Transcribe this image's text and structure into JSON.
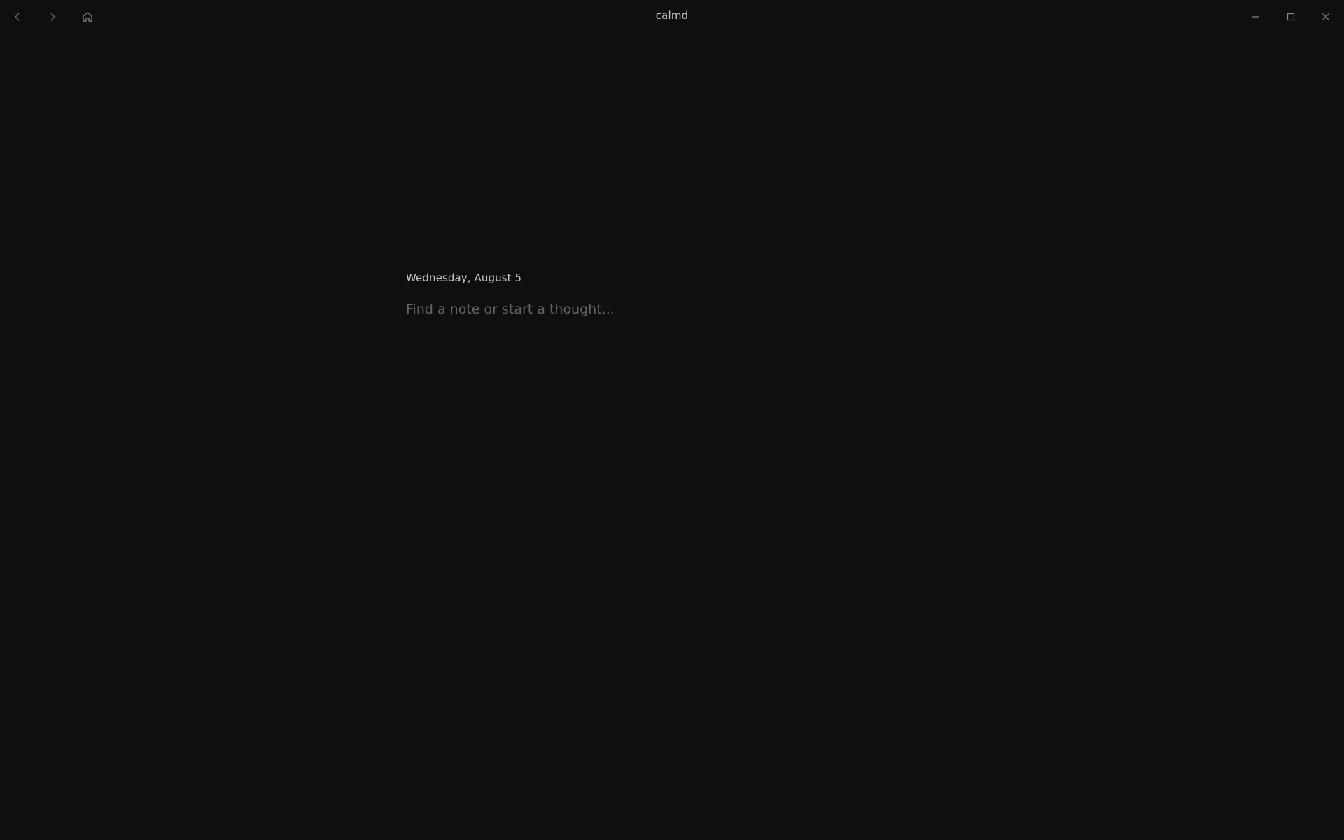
{
  "window": {
    "title": "calmd"
  },
  "titlebar": {
    "nav": {
      "back_icon": "chevron-left-icon",
      "forward_icon": "chevron-right-icon",
      "home_icon": "home-icon"
    },
    "controls": {
      "minimize_icon": "minimize-icon",
      "maximize_icon": "maximize-icon",
      "close_icon": "close-icon"
    }
  },
  "main": {
    "date": "Wednesday, August 5",
    "search": {
      "value": "",
      "placeholder": "Find a note or start a thought..."
    }
  },
  "colors": {
    "background": "#0f0f0f",
    "text": "#c9c9c9",
    "placeholder": "#646464",
    "icon": "#6e6e6e"
  }
}
